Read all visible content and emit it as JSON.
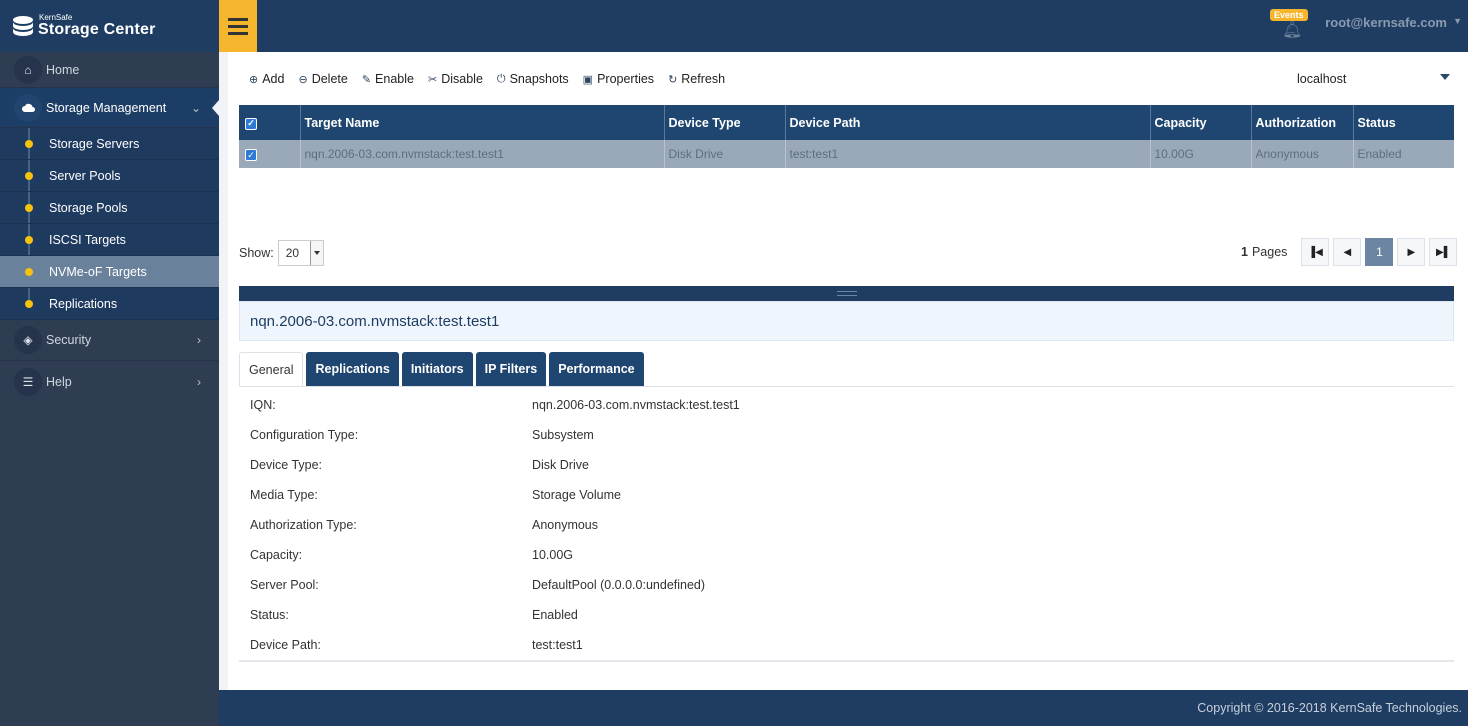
{
  "brand": {
    "small": "KernSafe",
    "big": "Storage Center"
  },
  "sidebar": {
    "items": [
      {
        "label": "Home",
        "icon": "home-icon"
      },
      {
        "label": "Storage Management",
        "icon": "cloud-icon"
      },
      {
        "label": "Security",
        "icon": "cube-icon"
      },
      {
        "label": "Help",
        "icon": "list-icon"
      }
    ],
    "sub_items": [
      {
        "label": "Storage Servers"
      },
      {
        "label": "Server Pools"
      },
      {
        "label": "Storage Pools"
      },
      {
        "label": "ISCSI Targets"
      },
      {
        "label": "NVMe-oF Targets"
      },
      {
        "label": "Replications"
      }
    ]
  },
  "header": {
    "events_label": "Events",
    "user": "root@kernsafe.com"
  },
  "toolbar": {
    "add": "Add",
    "delete": "Delete",
    "enable": "Enable",
    "disable": "Disable",
    "snapshots": "Snapshots",
    "properties": "Properties",
    "refresh": "Refresh",
    "host": "localhost"
  },
  "table": {
    "columns": [
      "Target Name",
      "Device Type",
      "Device Path",
      "Capacity",
      "Authorization",
      "Status"
    ],
    "rows": [
      {
        "target_name": "nqn.2006-03.com.nvmstack:test.test1",
        "device_type": "Disk Drive",
        "device_path": "test:test1",
        "capacity": "10.00G",
        "authorization": "Anonymous",
        "status": "Enabled"
      }
    ]
  },
  "pagination": {
    "show_label": "Show:",
    "page_size": "20",
    "pages_count": "1",
    "pages_label": "Pages",
    "current_page": "1"
  },
  "detail": {
    "title": "nqn.2006-03.com.nvmstack:test.test1",
    "tabs": [
      "General",
      "Replications",
      "Initiators",
      "IP Filters",
      "Performance"
    ],
    "properties": [
      {
        "key": "IQN:",
        "value": "nqn.2006-03.com.nvmstack:test.test1"
      },
      {
        "key": "Configuration Type:",
        "value": "Subsystem"
      },
      {
        "key": "Device Type:",
        "value": "Disk Drive"
      },
      {
        "key": "Media Type:",
        "value": "Storage Volume"
      },
      {
        "key": "Authorization Type:",
        "value": "Anonymous"
      },
      {
        "key": "Capacity:",
        "value": "10.00G"
      },
      {
        "key": "Server Pool:",
        "value": "DefaultPool (0.0.0.0:undefined)"
      },
      {
        "key": "Status:",
        "value": "Enabled"
      },
      {
        "key": "Device Path:",
        "value": "test:test1"
      }
    ]
  },
  "footer": {
    "copyright": "Copyright © 2016-2018 KernSafe Technologies."
  },
  "colors": {
    "navy": "#1f3d62",
    "accent": "#f5b52d",
    "selected_row": "#9aa9ba",
    "dot": "#f4c20d"
  }
}
